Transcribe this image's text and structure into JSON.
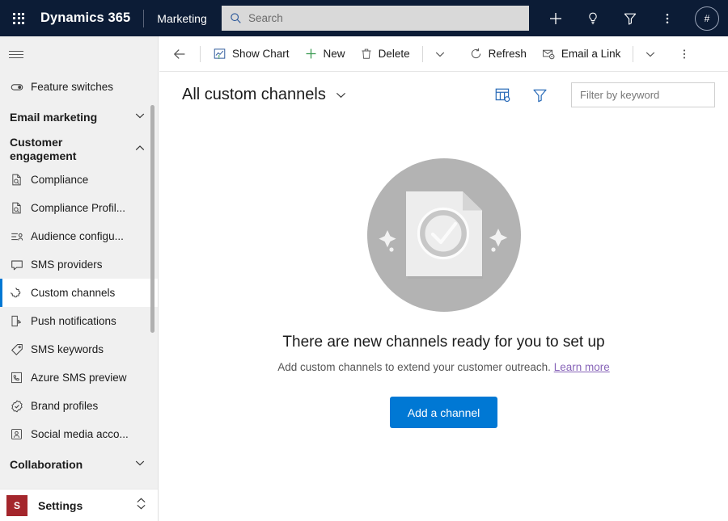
{
  "topnav": {
    "waffle_label": "App launcher",
    "brand": "Dynamics 365",
    "app_name": "Marketing",
    "search_placeholder": "Search",
    "search_value": "",
    "icons": {
      "waffle": "waffle-icon",
      "search": "search-icon",
      "plus": "plus-icon",
      "lightbulb": "lightbulb-icon",
      "filter": "filter-icon",
      "more": "more-vertical-icon"
    },
    "avatar_initial": "#"
  },
  "sidebar": {
    "hamburger_label": "Expand / collapse menu",
    "items": [
      {
        "label": "Feature switches",
        "icon": "toggle-icon",
        "type": "item",
        "selected": false
      },
      {
        "label": "Email marketing",
        "icon": "chevron-down-icon",
        "type": "group",
        "expanded": false
      },
      {
        "label": "Customer engagement",
        "icon": "chevron-up-icon",
        "type": "group",
        "expanded": true
      },
      {
        "label": "Compliance",
        "icon": "document-search-icon",
        "type": "item",
        "selected": false
      },
      {
        "label": "Compliance Profil...",
        "icon": "document-search-icon",
        "type": "item",
        "selected": false
      },
      {
        "label": "Audience configu...",
        "icon": "audience-list-icon",
        "type": "item",
        "selected": false
      },
      {
        "label": "SMS providers",
        "icon": "chat-bubble-icon",
        "type": "item",
        "selected": false
      },
      {
        "label": "Custom channels",
        "icon": "puzzle-icon",
        "type": "item",
        "selected": true
      },
      {
        "label": "Push notifications",
        "icon": "push-notification-icon",
        "type": "item",
        "selected": false
      },
      {
        "label": "SMS keywords",
        "icon": "tag-icon",
        "type": "item",
        "selected": false
      },
      {
        "label": "Azure SMS preview",
        "icon": "azure-phone-icon",
        "type": "item",
        "selected": false
      },
      {
        "label": "Brand profiles",
        "icon": "badge-check-icon",
        "type": "item",
        "selected": false
      },
      {
        "label": "Social media acco...",
        "icon": "person-frame-icon",
        "type": "item",
        "selected": false
      },
      {
        "label": "Collaboration",
        "icon": "chevron-down-icon",
        "type": "group",
        "expanded": false
      }
    ],
    "footer": {
      "area_badge": "S",
      "area_label": "Settings",
      "switcher_icon": "up-down-chevron-icon"
    }
  },
  "commandbar": {
    "back_icon": "arrow-left-icon",
    "commands": [
      {
        "label": "Show Chart",
        "icon": "chart-icon"
      },
      {
        "label": "New",
        "icon": "plus-green-icon"
      },
      {
        "label": "Delete",
        "icon": "trash-icon"
      },
      {
        "label": "Refresh",
        "icon": "refresh-icon"
      },
      {
        "label": "Email a Link",
        "icon": "email-link-icon"
      }
    ],
    "overflow_chevron_icon": "chevron-down-icon",
    "more_icon": "more-vertical-icon"
  },
  "viewbar": {
    "view_name": "All custom channels",
    "view_chevron_icon": "chevron-down-icon",
    "edit_columns_icon": "edit-columns-icon",
    "filter_icon": "filter-icon",
    "keyword_filter_placeholder": "Filter by keyword",
    "keyword_filter_value": ""
  },
  "empty_state": {
    "illustration_icon": "document-check-sparkle-illustration",
    "heading": "There are new channels ready for you to set up",
    "subtext": "Add custom channels to extend your customer outreach.",
    "learn_more_label": "Learn more",
    "primary_button_label": "Add a channel"
  },
  "colors": {
    "topnav_bg": "#0c1c36",
    "accent_blue": "#0078d4",
    "sidebar_bg": "#f0f0f0",
    "selection_bar": "#0078d4",
    "settings_badge": "#a4262c",
    "link_purple": "#8764b8",
    "new_green": "#3a9b52"
  }
}
